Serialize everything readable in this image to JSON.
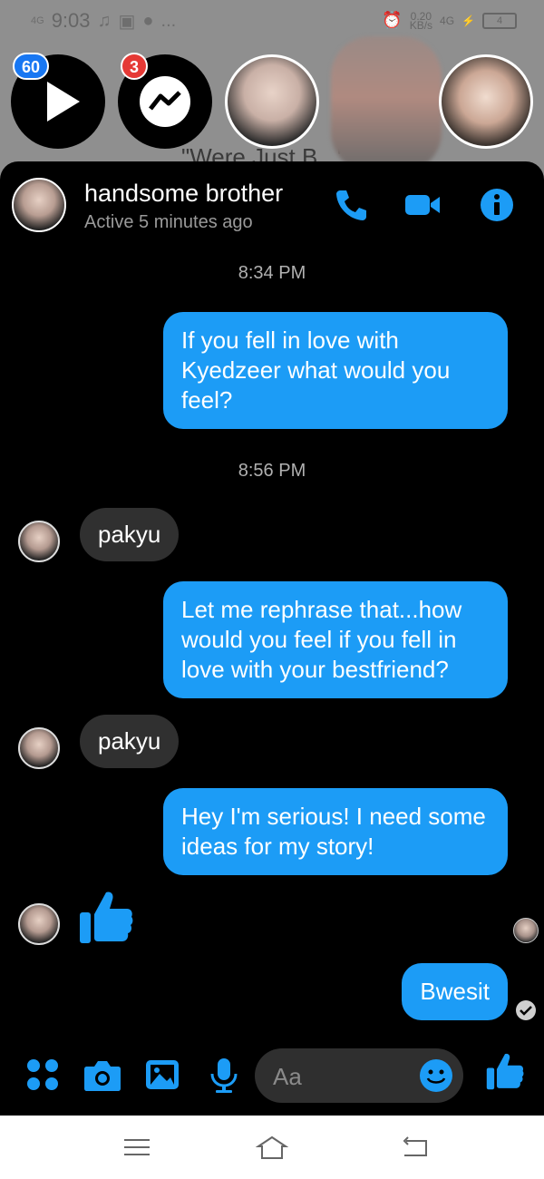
{
  "status_bar": {
    "network": "4G",
    "time": "9:03",
    "more": "...",
    "speed": "0.20",
    "speed_unit": "KB/s",
    "net_type": "4G",
    "battery": "4"
  },
  "background": {
    "caption": "\"Were Just B...\""
  },
  "chat_heads": {
    "play_badge": "60",
    "messenger_badge": "3"
  },
  "header": {
    "name": "handsome brother",
    "status": "Active 5 minutes ago"
  },
  "messages": [
    {
      "type": "timestamp",
      "text": "8:34 PM"
    },
    {
      "type": "outgoing",
      "text": "If you fell in love with Kyedzeer what would you feel?"
    },
    {
      "type": "timestamp",
      "text": "8:56 PM"
    },
    {
      "type": "incoming",
      "text": "pakyu"
    },
    {
      "type": "outgoing",
      "text": "Let me rephrase that...how would you feel if you fell in love with your bestfriend?"
    },
    {
      "type": "incoming",
      "text": "pakyu"
    },
    {
      "type": "outgoing",
      "text": "Hey I'm serious! I need some ideas for my story!"
    },
    {
      "type": "incoming_like",
      "icon": "thumbs-up-icon"
    },
    {
      "type": "outgoing",
      "text": "Bwesit"
    }
  ],
  "composer": {
    "placeholder": "Aa"
  },
  "colors": {
    "accent": "#1c9cf6",
    "panel": "#000000",
    "incoming_bubble": "#303030"
  }
}
